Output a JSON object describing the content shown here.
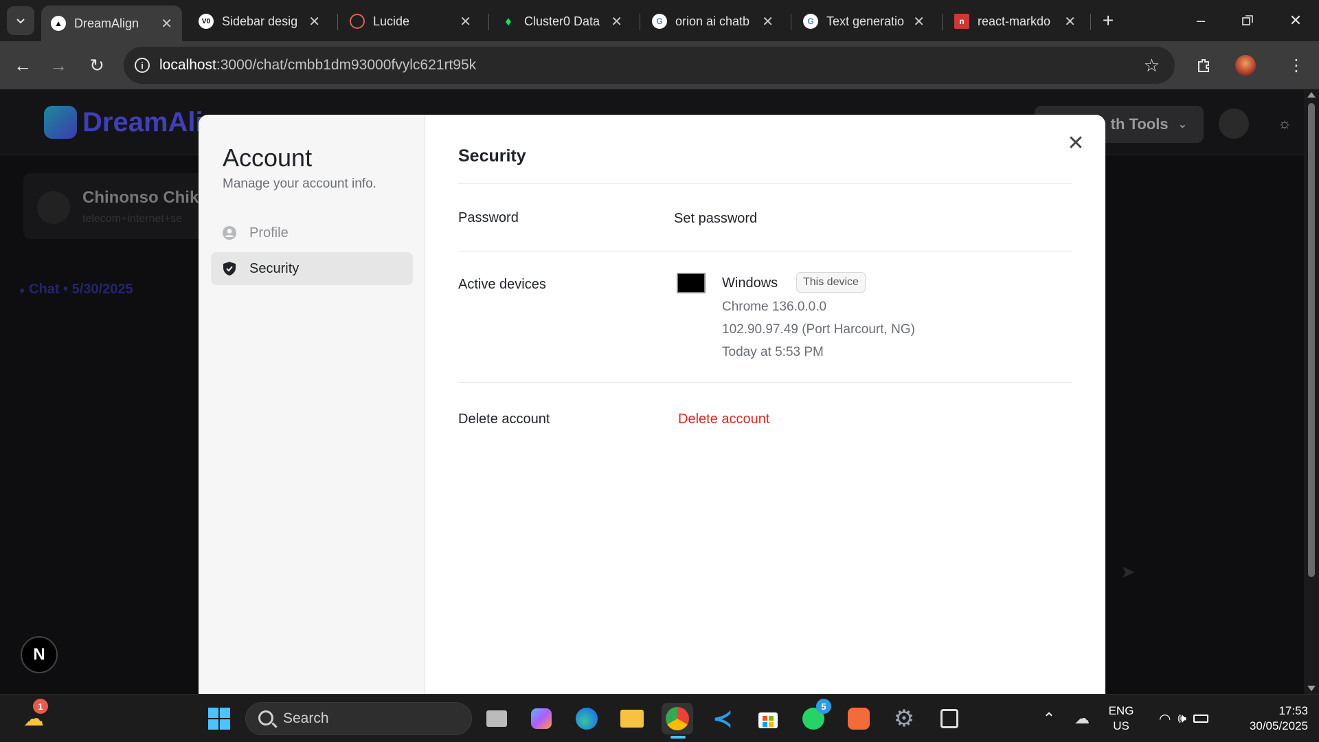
{
  "browser": {
    "tabs": [
      {
        "title": "DreamAlign",
        "icon": "triangle-logo-icon",
        "active": true
      },
      {
        "title": "Sidebar desig",
        "icon": "vercel-icon"
      },
      {
        "title": "Lucide",
        "icon": "lucide-icon"
      },
      {
        "title": "Cluster0 Data",
        "icon": "mongodb-leaf-icon"
      },
      {
        "title": "orion ai chatb",
        "icon": "google-icon"
      },
      {
        "title": "Text generatio",
        "icon": "google-icon"
      },
      {
        "title": "react-markdo",
        "icon": "npm-icon"
      }
    ],
    "url_host": "localhost",
    "url_rest": ":3000/chat/cmbb1dm93000fvylc621rt95k"
  },
  "background_page": {
    "logo_text": "DreamAli",
    "growth_tools_label": "th Tools",
    "user_name": "Chinonso Chike",
    "user_sub": "telecom+internet+se",
    "chat_link": "Chat • 5/30/2025",
    "next_badge": "N"
  },
  "modal": {
    "title": "Account",
    "subtitle": "Manage your account info.",
    "nav": {
      "profile": "Profile",
      "security": "Security"
    },
    "close": "✕",
    "section_title": "Security",
    "password": {
      "label": "Password",
      "action": "Set password"
    },
    "devices": {
      "label": "Active devices",
      "name": "Windows",
      "badge": "This device",
      "browser": "Chrome 136.0.0.0",
      "location": "102.90.97.49 (Port Harcourt, NG)",
      "last_active": "Today at 5:53 PM"
    },
    "delete": {
      "label": "Delete account",
      "action": "Delete account"
    }
  },
  "taskbar": {
    "weather_badge": "1",
    "search_placeholder": "Search",
    "whatsapp_badge": "5",
    "lang_top": "ENG",
    "lang_bottom": "US",
    "time": "17:53",
    "date": "30/05/2025"
  },
  "colors": {
    "danger": "#dc2626",
    "accent": "#4cc2ff"
  }
}
